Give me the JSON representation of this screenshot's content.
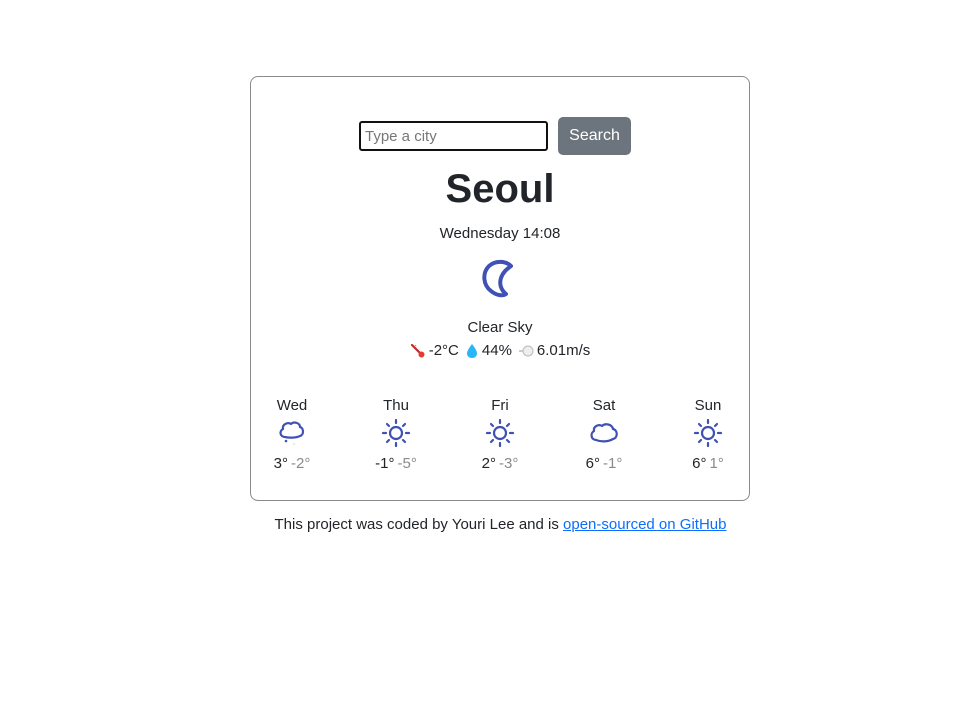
{
  "search": {
    "placeholder": "Type a city",
    "value": "",
    "button_label": "Search"
  },
  "current": {
    "city": "Seoul",
    "datetime": "Wednesday 14:08",
    "icon": "moon-icon",
    "description": "Clear Sky",
    "temperature": "-2°C",
    "humidity": "44%",
    "wind": "6.01m/s"
  },
  "forecast": [
    {
      "day": "Wed",
      "icon": "cloud-rain-icon",
      "max": "3°",
      "min": "-2°"
    },
    {
      "day": "Thu",
      "icon": "sun-icon",
      "max": "-1°",
      "min": "-5°"
    },
    {
      "day": "Fri",
      "icon": "sun-icon",
      "max": "2°",
      "min": "-3°"
    },
    {
      "day": "Sat",
      "icon": "cloud-icon",
      "max": "6°",
      "min": "-1°"
    },
    {
      "day": "Sun",
      "icon": "sun-icon",
      "max": "6°",
      "min": "1°"
    }
  ],
  "footer": {
    "text": "This project was coded by Youri Lee and is ",
    "link_text": "open-sourced on GitHub"
  },
  "colors": {
    "icon": "#3f51b5",
    "button": "#6c757d",
    "link": "#0d6efd"
  }
}
